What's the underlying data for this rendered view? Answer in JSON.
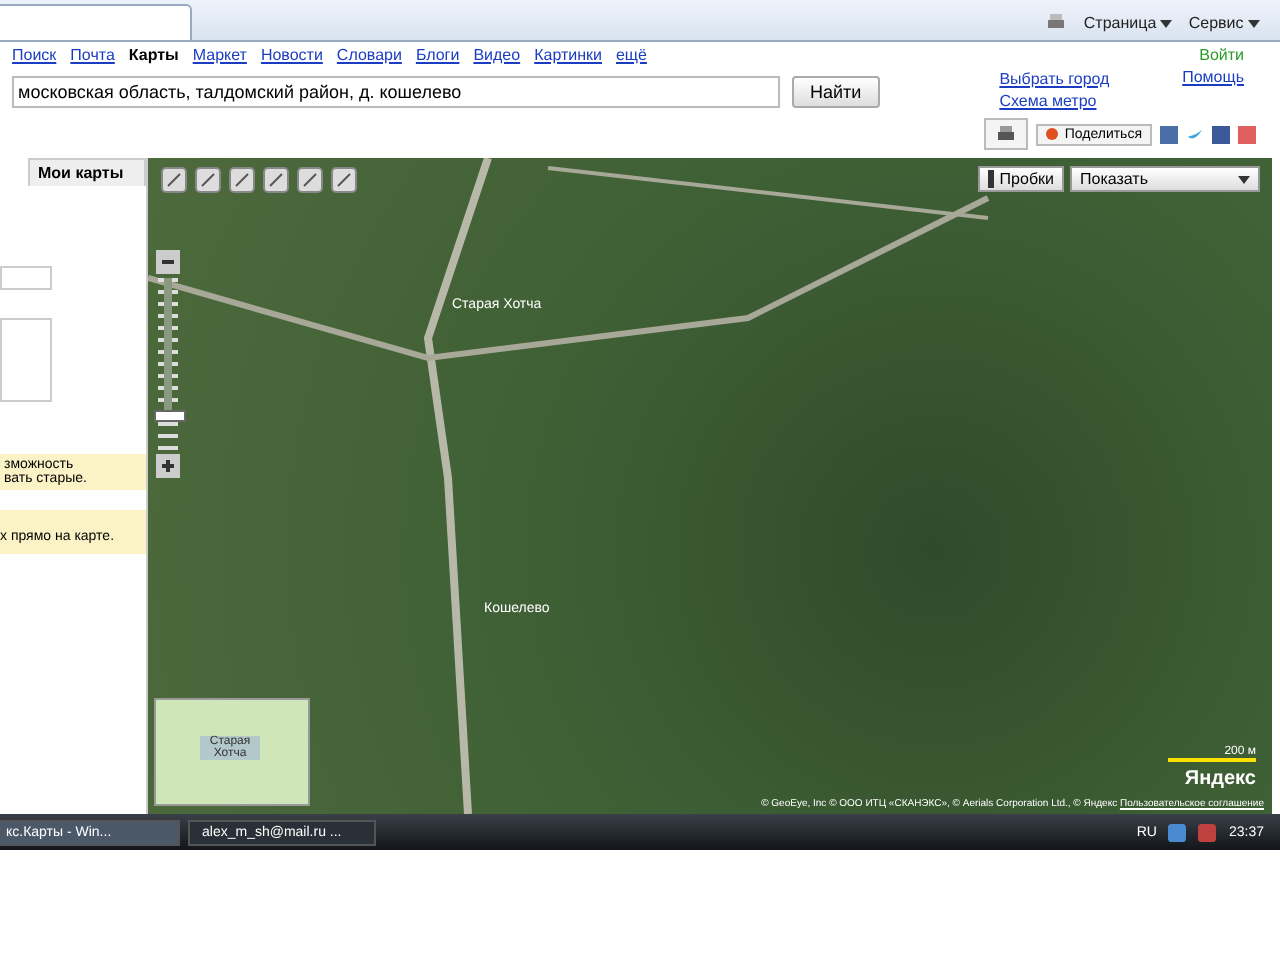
{
  "browser_toolbar": {
    "items": [
      {
        "kind": "icon"
      },
      {
        "kind": "menu",
        "label": "Страница"
      },
      {
        "kind": "menu",
        "label": "Сервис"
      }
    ]
  },
  "nav": {
    "links": [
      {
        "label": "Поиск",
        "selected": false
      },
      {
        "label": "Почта",
        "selected": false
      },
      {
        "label": "Карты",
        "selected": true
      },
      {
        "label": "Маркет",
        "selected": false
      },
      {
        "label": "Новости",
        "selected": false
      },
      {
        "label": "Словари",
        "selected": false
      },
      {
        "label": "Блоги",
        "selected": false
      },
      {
        "label": "Видео",
        "selected": false
      },
      {
        "label": "Картинки",
        "selected": false
      },
      {
        "label": "ещё",
        "selected": false
      }
    ],
    "login": "Войти",
    "help": "Помощь"
  },
  "search": {
    "value": "московская область, талдомский район, д. кошелево",
    "button": "Найти"
  },
  "city_links": [
    "Выбрать город",
    "Схема метро"
  ],
  "share": {
    "label": "Поделиться"
  },
  "left_panel": {
    "tab": "Мои карты",
    "notice": [
      "зможность",
      "вать старые."
    ],
    "hint": "х прямо на карте."
  },
  "map": {
    "traffic": "Пробки",
    "show": "Показать",
    "zoom": {
      "level": 0.8
    },
    "labels": [
      {
        "text": "Старая Хотча"
      },
      {
        "text": "Кошелево"
      }
    ],
    "minimap_label": "Старая Хотча",
    "scale": "200 м",
    "logo": "Яндекс",
    "copyright": "© GeoEye, Inc © ООО ИТЦ «СКАНЭКС», © Aerials Corporation Ltd., © Яндекс",
    "agreement": "Пользовательское соглашение"
  },
  "taskbar": {
    "tasks": [
      {
        "label": "кс.Карты - Win...",
        "selected": true
      },
      {
        "label": "alex_m_sh@mail.ru ...",
        "selected": false
      }
    ],
    "lang": "RU",
    "time": "23:37"
  }
}
